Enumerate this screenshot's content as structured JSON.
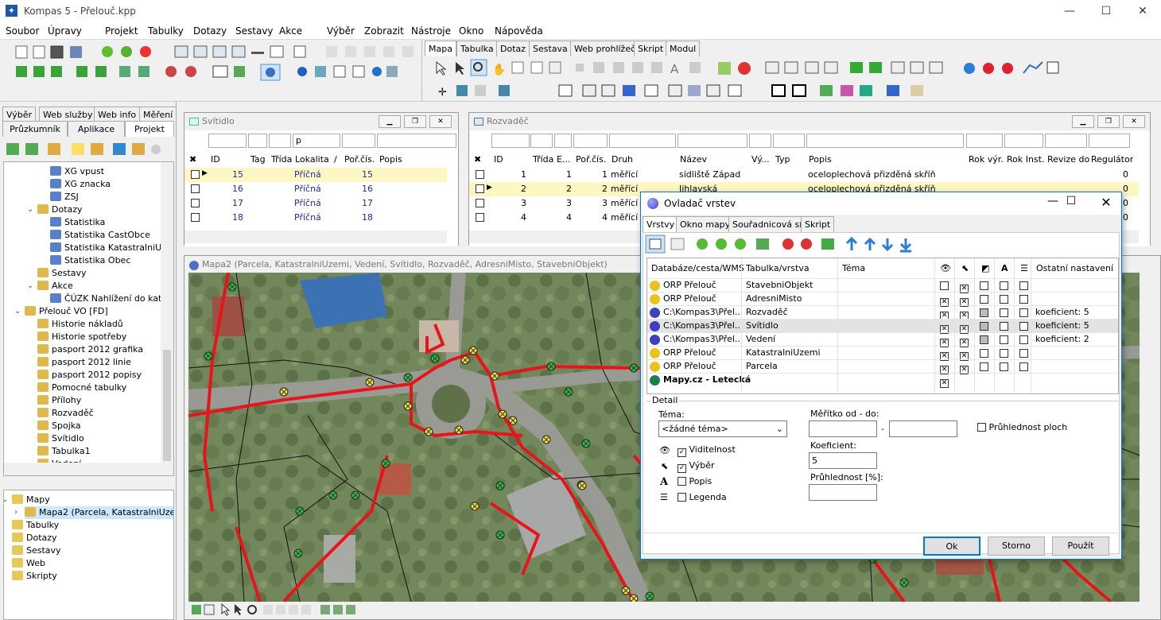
{
  "app": {
    "title": "Kompas 5 - Přelouč.kpp",
    "icon": "app-compass-icon"
  },
  "window_controls": {
    "minimize": "—",
    "maximize": "☐",
    "close": "✕"
  },
  "menu": [
    "Soubor",
    "Úpravy",
    "Projekt",
    "Tabulky",
    "Dotazy",
    "Sestavy",
    "Akce",
    "Výběr",
    "Zobrazit",
    "Nástroje",
    "Okno",
    "Nápověda"
  ],
  "right_tabs": [
    "Mapa",
    "Tabulka",
    "Dotaz",
    "Sestava",
    "Web prohlížeč",
    "Skript",
    "Modul"
  ],
  "left_tabs_row1": [
    "Výběr",
    "Web služby",
    "Web info",
    "Měření"
  ],
  "left_tabs_row2": [
    "Průzkumník",
    "Aplikace",
    "Projekt"
  ],
  "tree_top": [
    {
      "label": "XG vpust",
      "indent": 3
    },
    {
      "label": "XG znacka",
      "indent": 3
    },
    {
      "label": "ZSJ",
      "indent": 3
    },
    {
      "label": "Dotazy",
      "indent": 2,
      "expander": "v"
    },
    {
      "label": "Statistika",
      "indent": 3
    },
    {
      "label": "Statistika CastObce",
      "indent": 3
    },
    {
      "label": "Statistika KatastralniUze",
      "indent": 3
    },
    {
      "label": "Statistika Obec",
      "indent": 3
    },
    {
      "label": "Sestavy",
      "indent": 2
    },
    {
      "label": "Akce",
      "indent": 2,
      "expander": "v"
    },
    {
      "label": "ČÚZK Nahlížení do katas",
      "indent": 3
    },
    {
      "label": "Přelouč VO [FD]",
      "indent": 1,
      "expander": "v"
    },
    {
      "label": "Historie nákladů",
      "indent": 2
    },
    {
      "label": "Historie spotřeby",
      "indent": 2
    },
    {
      "label": "pasport  2012 grafika",
      "indent": 2
    },
    {
      "label": "pasport 2012 linie",
      "indent": 2
    },
    {
      "label": "pasport 2012 popisy",
      "indent": 2
    },
    {
      "label": "Pomocné tabulky",
      "indent": 2
    },
    {
      "label": "Přílohy",
      "indent": 2
    },
    {
      "label": "Rozvaděč",
      "indent": 2
    },
    {
      "label": "Spojka",
      "indent": 2
    },
    {
      "label": "Svítidlo",
      "indent": 2
    },
    {
      "label": "Tabulka1",
      "indent": 2
    },
    {
      "label": "Vedení",
      "indent": 2
    }
  ],
  "tree_bottom": [
    {
      "label": "Mapy",
      "indent": 0,
      "expander": "v"
    },
    {
      "label": "Mapa2 (Parcela, KatastralniUze",
      "indent": 1,
      "expander": ">",
      "selected": true
    },
    {
      "label": "Tabulky",
      "indent": 0,
      "expander": ">"
    },
    {
      "label": "Dotazy",
      "indent": 0
    },
    {
      "label": "Sestavy",
      "indent": 0
    },
    {
      "label": "Web",
      "indent": 0
    },
    {
      "label": "Skripty",
      "indent": 0
    }
  ],
  "svitidlo": {
    "title": "Svítidlo",
    "filter_value": "p",
    "headers": [
      "ID",
      "Tag",
      "Třída",
      "Lokalita",
      "/",
      "Poř.čís.",
      "Popis"
    ],
    "rows": [
      {
        "id": "15",
        "lokalita": "Příčná",
        "por": "15"
      },
      {
        "id": "16",
        "lokalita": "Příčná",
        "por": "16"
      },
      {
        "id": "17",
        "lokalita": "Příčná",
        "por": "17"
      },
      {
        "id": "18",
        "lokalita": "Příčná",
        "por": "18"
      }
    ]
  },
  "rozvadec": {
    "title": "Rozvaděč",
    "headers": [
      "ID",
      "Třída",
      "E...",
      "Poř.čís.",
      "Druh",
      "Název",
      "Vý...",
      "Typ",
      "Popis",
      "Rok výr.",
      "Rok Inst.",
      "Revize do",
      "Regulátor"
    ],
    "rows": [
      {
        "id": "1",
        "e": "1",
        "por": "1",
        "druh": "měřící",
        "nazev": "sídliště Západ",
        "popis": "oceloplechová přizděná skříň",
        "reg": "0"
      },
      {
        "id": "2",
        "e": "2",
        "por": "2",
        "druh": "měřící",
        "nazev": "Jihlavská",
        "popis": "oceloplechová přizděná skříň",
        "reg": "0"
      },
      {
        "id": "3",
        "e": "3",
        "por": "3",
        "druh": "měřící",
        "nazev": "",
        "popis": "",
        "reg": "0"
      },
      {
        "id": "4",
        "e": "4",
        "por": "4",
        "druh": "měřící",
        "nazev": "",
        "popis": "",
        "reg": "0"
      }
    ]
  },
  "map_window": {
    "title": "Mapa2 (Parcela, KatastralniUzemi, Vedení, Svítidlo, Rozvaděč, AdresniMisto, StavebniObjekt)"
  },
  "dialog": {
    "title": "Ovladač vrstev",
    "tabs": [
      "Vrstvy",
      "Okno mapy",
      "Souřadnicová síť",
      "Skript"
    ],
    "headers": [
      "Databáze/cesta/WMS",
      "Tabulka/vrstva",
      "Téma",
      "Ostatní nastavení"
    ],
    "layers": [
      {
        "db": "ORP Přelouč",
        "table": "StavebniObjekt",
        "vis": "",
        "sel": "x",
        "note": ""
      },
      {
        "db": "ORP Přelouč",
        "table": "AdresniMisto",
        "vis": "x",
        "sel": "x",
        "note": ""
      },
      {
        "db": "C:\\Kompas3\\Přel...",
        "table": "Rozvaděč",
        "vis": "x",
        "sel": "x",
        "note": "koeficient: 5"
      },
      {
        "db": "C:\\Kompas3\\Přel...",
        "table": "Svítidlo",
        "vis": "x",
        "sel": "x",
        "note": "koeficient: 5",
        "selected": true
      },
      {
        "db": "C:\\Kompas3\\Přel...",
        "table": "Vedení",
        "vis": "x",
        "sel": "x",
        "note": "koeficient: 2"
      },
      {
        "db": "ORP Přelouč",
        "table": "KatastralniUzemi",
        "vis": "x",
        "sel": "x",
        "note": ""
      },
      {
        "db": "ORP Přelouč",
        "table": "Parcela",
        "vis": "x",
        "sel": "x",
        "note": ""
      },
      {
        "db": "Mapy.cz - Letecká",
        "table": "",
        "vis": "x",
        "sel": "",
        "note": ""
      }
    ],
    "detail": {
      "group": "Detail",
      "tema_label": "Téma:",
      "tema_value": "<žádné téma>",
      "viditelnost": "Viditelnost",
      "vyber": "Výběr",
      "popis": "Popis",
      "legenda": "Legenda",
      "meritko_label": "Měřítko od - do:",
      "dash": "-",
      "koeficient_label": "Koeficient:",
      "koeficient_value": "5",
      "pruhlednost_label": "Průhlednost [%]:",
      "pruhlednost_ploch": "Průhlednost ploch"
    },
    "buttons": {
      "ok": "Ok",
      "cancel": "Storno",
      "apply": "Použít"
    }
  },
  "colors": {
    "accent": "#0078d7",
    "map_line": "#e8141c",
    "lamp_yellow": "#f1e13a",
    "lamp_green": "#29c23a",
    "selected_row": "#fff7c2"
  }
}
